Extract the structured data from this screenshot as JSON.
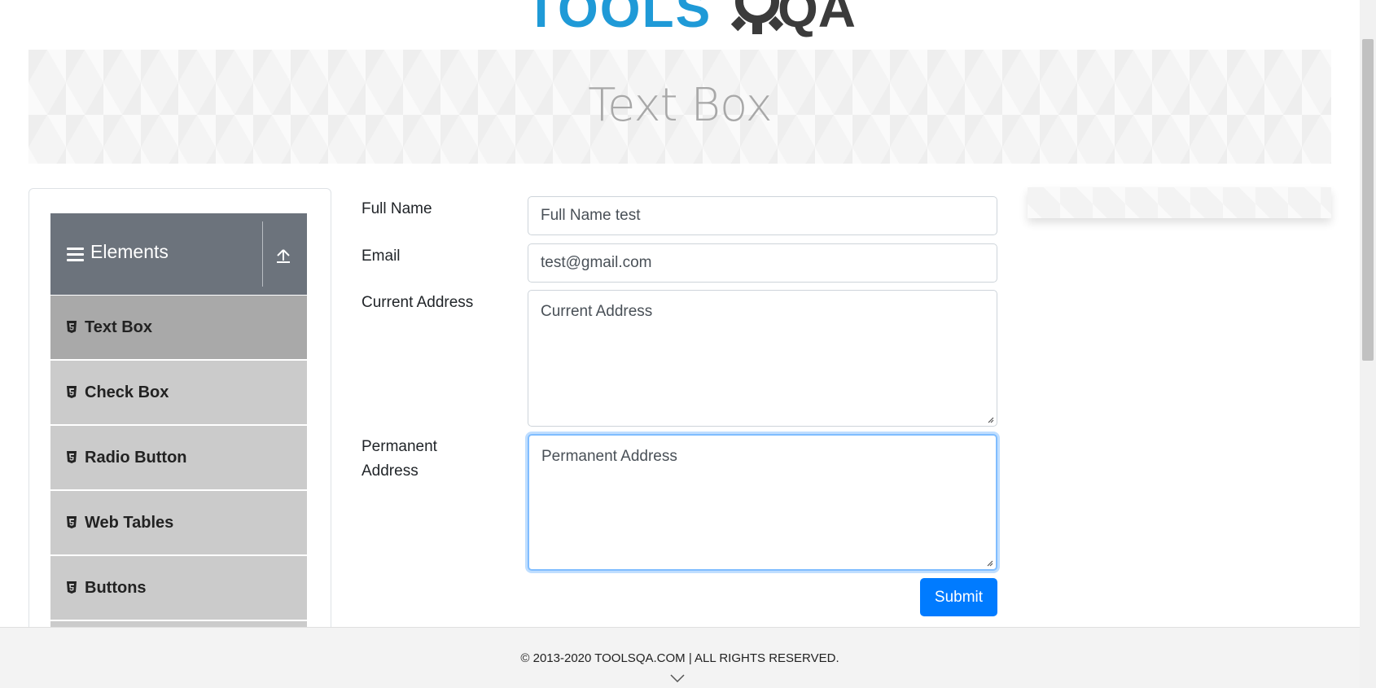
{
  "logo": {
    "text_blue": "TOOLS",
    "text_dark": "QA",
    "icon": "gear-icon"
  },
  "banner": {
    "title": "Text Box"
  },
  "sidebar": {
    "group_title": "Elements",
    "group_icon": "hamburger-icon",
    "collapse_icon": "upload-arrow-icon",
    "items": [
      {
        "label": "Text Box",
        "icon": "html5-icon",
        "active": true
      },
      {
        "label": "Check Box",
        "icon": "html5-icon"
      },
      {
        "label": "Radio Button",
        "icon": "html5-icon"
      },
      {
        "label": "Web Tables",
        "icon": "html5-icon"
      },
      {
        "label": "Buttons",
        "icon": "html5-icon"
      }
    ]
  },
  "form": {
    "full_name": {
      "label": "Full Name",
      "value": "Full Name test"
    },
    "email": {
      "label": "Email",
      "value": "test@gmail.com"
    },
    "current_address": {
      "label": "Current Address",
      "placeholder": "Current Address"
    },
    "permanent_address": {
      "label_line1": "Permanent",
      "label_line2": "Address",
      "placeholder": "Permanent Address"
    },
    "submit_label": "Submit"
  },
  "footer": {
    "text": "© 2013-2020 TOOLSQA.COM | ALL RIGHTS RESERVED."
  },
  "colors": {
    "accent": "#007bff",
    "header_gray": "#6c737c",
    "active_item": "#a9a9a9",
    "item_bg": "#cbcbcb"
  }
}
